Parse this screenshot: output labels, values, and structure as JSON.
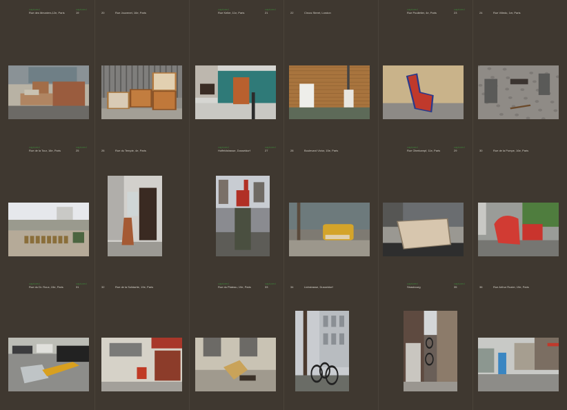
{
  "tag_label": "captured",
  "captions": [
    {
      "page": "19",
      "location": "Rue des Meuniers,12e, Paris"
    },
    {
      "page": "20",
      "location": "Rue Jouvenet, 16e, Paris"
    },
    {
      "page": "21",
      "location": "Rue Keller, 11e, Paris"
    },
    {
      "page": "22",
      "location": "Circus Street, London"
    },
    {
      "page": "23",
      "location": "Rue Poulletier, 4e, Paris"
    },
    {
      "page": "24",
      "location": "Rue Villedo, 1er, Paris"
    },
    {
      "page": "25",
      "location": "Rue de la Tour, 16e, Paris"
    },
    {
      "page": "26",
      "location": "Rue du Temple, 4e, Paris"
    },
    {
      "page": "27",
      "location": "Hoffeldstrasse, Dusseldorf"
    },
    {
      "page": "28",
      "location": "Boulevard Victor, 15e, Paris"
    },
    {
      "page": "29",
      "location": "Rue Oberkampf, 11e, Paris"
    },
    {
      "page": "30",
      "location": "Rue de la Pompe, 16e, Paris"
    },
    {
      "page": "31",
      "location": "Rue du Dr. Roux, 15e, Paris"
    },
    {
      "page": "32",
      "location": "Rue de la Solidarite, 19e, Paris"
    },
    {
      "page": "33",
      "location": "Rue du Plateau, 19e, Paris"
    },
    {
      "page": "34",
      "location": "Lichstrasse, Dusseldorf"
    },
    {
      "page": "35",
      "location": "Strasbourg"
    },
    {
      "page": "36",
      "location": "Rue Arthur Rozier, 19e, Paris"
    }
  ],
  "photos": [
    {
      "label": "cardboard boxes and shelves on sidewalk"
    },
    {
      "label": "wooden drawers in front of gate"
    },
    {
      "label": "wardrobe and sign in front of green fence"
    },
    {
      "label": "white refrigerator against brick wall"
    },
    {
      "label": "red piece of furniture on pavement"
    },
    {
      "label": "bins and broken chair on cobblestones"
    },
    {
      "label": "cafe terrace with chairs"
    },
    {
      "label": "folding ladder beside doorway"
    },
    {
      "label": "red chair on top of pillar"
    },
    {
      "label": "yellow armchair on street"
    },
    {
      "label": "beige sofa on sidewalk"
    },
    {
      "label": "red armchair in courtyard"
    },
    {
      "label": "toppled chair near parked cars"
    },
    {
      "label": "red object by garage door"
    },
    {
      "label": "yellow furniture on steps"
    },
    {
      "label": "bicycles and tree on street"
    },
    {
      "label": "bicycle in narrow alley"
    },
    {
      "label": "blue portable toilet on street"
    }
  ]
}
